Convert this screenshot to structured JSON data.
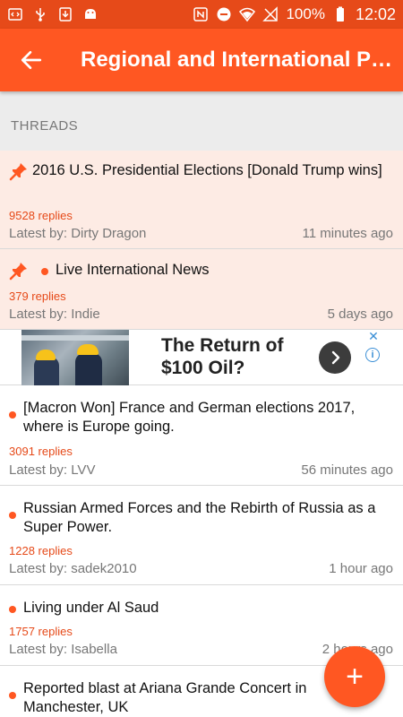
{
  "status_bar": {
    "icons_left": [
      "code-icon",
      "usb-icon",
      "download-icon",
      "android-icon"
    ],
    "icons_right": [
      "nfc-icon",
      "do-not-disturb-icon",
      "wifi-icon",
      "no-signal-icon"
    ],
    "battery": "100%",
    "time": "12:02"
  },
  "app_bar": {
    "title": "Regional and International Po…",
    "back_icon": "arrow-back-icon",
    "color": "#ff5722"
  },
  "section": {
    "label": "THREADS"
  },
  "threads": [
    {
      "title": "2016 U.S. Presidential Elections [Donald Trump wins]",
      "replies": "9528 replies",
      "latest": "Latest by: Dirty Dragon",
      "time": "11 minutes ago",
      "pinned": true,
      "unread": false
    },
    {
      "title": "Live International News",
      "replies": "379 replies",
      "latest": "Latest by: Indie",
      "time": "5 days ago",
      "pinned": true,
      "unread": true
    },
    {
      "title": "[Macron Won] France and German elections 2017, where is Europe going.",
      "replies": "3091 replies",
      "latest": "Latest by: LVV",
      "time": "56 minutes ago",
      "pinned": false,
      "unread": true
    },
    {
      "title": "Russian Armed Forces and the Rebirth of Russia as a Super Power.",
      "replies": "1228 replies",
      "latest": "Latest by: sadek2010",
      "time": "1 hour ago",
      "pinned": false,
      "unread": true
    },
    {
      "title": "Living under Al Saud",
      "replies": "1757 replies",
      "latest": "Latest by: Isabella",
      "time": "2 hours ago",
      "pinned": false,
      "unread": true
    },
    {
      "title": "Reported blast at Ariana Grande Concert in Manchester, UK",
      "pinned": false,
      "unread": true
    }
  ],
  "ad": {
    "title": "The Return of $100 Oil?",
    "arrow_icon": "chevron-right-icon",
    "close_icon": "close-icon",
    "info_icon": "info-icon"
  },
  "fab": {
    "label": "+",
    "icon": "add-icon"
  },
  "colors": {
    "accent": "#ff5722",
    "pinned_bg": "#fdebe4",
    "replies": "#e64a19"
  }
}
